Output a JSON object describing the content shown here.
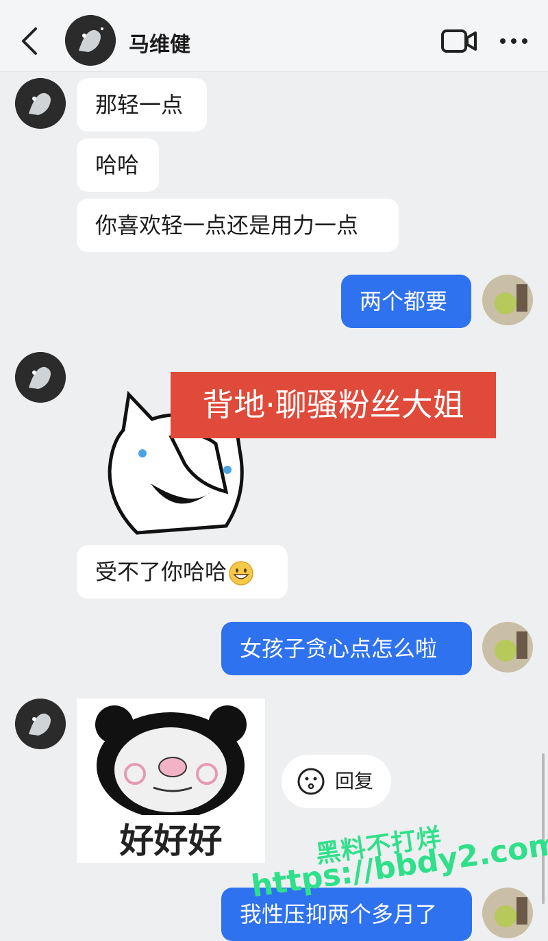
{
  "header": {
    "contact_name": "马维健",
    "back_icon": "chevron-left-icon",
    "video_icon": "video-camera-icon",
    "more_icon": "more-dots-icon"
  },
  "messages": [
    {
      "side": "in",
      "text": "那轻一点"
    },
    {
      "side": "in",
      "text": "哈哈"
    },
    {
      "side": "in",
      "text": "你喜欢轻一点还是用力一点"
    },
    {
      "side": "out",
      "text": "两个都要"
    },
    {
      "side": "in",
      "type": "sticker",
      "sticker": "cat-covering-face-laughing"
    },
    {
      "side": "in",
      "text": "受不了你哈哈",
      "emoji": "grinning-face"
    },
    {
      "side": "out",
      "text": "女孩子贪心点怎么啦"
    },
    {
      "side": "in",
      "type": "sticker",
      "sticker": "panda-blushing",
      "caption": "好好好"
    },
    {
      "side": "out",
      "text": "我性压抑两个多月了"
    }
  ],
  "overlay_banner": "背地·聊骚粉丝大姐",
  "reply_button": {
    "label": "回复",
    "icon": "emoji-face-icon"
  },
  "watermark": {
    "line1": "黑料不打烊",
    "line2": "https://bbdy2.com"
  },
  "colors": {
    "accent": "#2f72f0",
    "banner": "#e04a3a",
    "background": "#eeeff1",
    "watermark": "#2fe08a"
  }
}
